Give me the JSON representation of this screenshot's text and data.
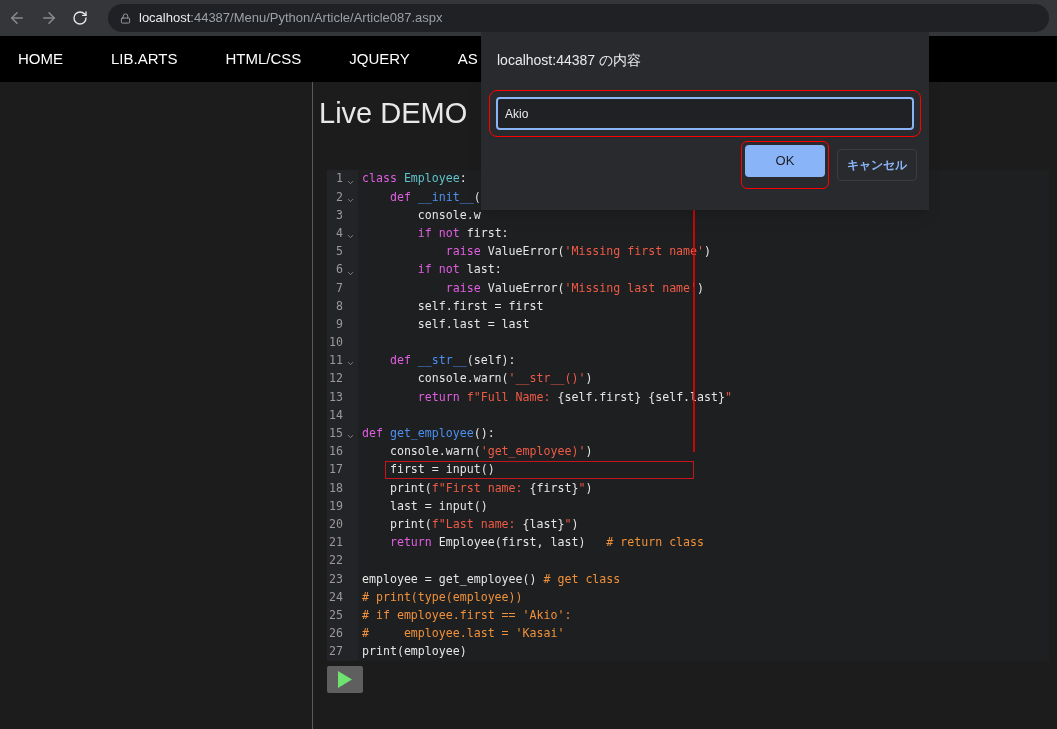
{
  "browser": {
    "url_host": "localhost",
    "url_path": ":44387/Menu/Python/Article/Article087.aspx"
  },
  "nav": [
    "HOME",
    "LIB.ARTS",
    "HTML/CSS",
    "JQUERY",
    "AS"
  ],
  "page_title": "Live DEMO",
  "code_lines": [
    {
      "number": "1",
      "foldable": true,
      "highlighted": false,
      "tokens": [
        {
          "kind": "keyword",
          "text": "class"
        },
        {
          "kind": "class",
          "text": " Employee"
        },
        {
          "kind": "plain",
          "text": ":"
        }
      ]
    },
    {
      "number": "2",
      "foldable": true,
      "highlighted": false,
      "tokens": [
        {
          "kind": "keyword",
          "text": "    def"
        },
        {
          "kind": "function",
          "text": " __init__"
        },
        {
          "kind": "plain",
          "text": "("
        }
      ]
    },
    {
      "number": "3",
      "foldable": false,
      "highlighted": false,
      "tokens": [
        {
          "kind": "plain",
          "text": "        console.w"
        }
      ]
    },
    {
      "number": "4",
      "foldable": true,
      "highlighted": false,
      "tokens": [
        {
          "kind": "keyword",
          "text": "        if not"
        },
        {
          "kind": "plain",
          "text": " first:"
        }
      ]
    },
    {
      "number": "5",
      "foldable": false,
      "highlighted": false,
      "tokens": [
        {
          "kind": "keyword",
          "text": "            raise"
        },
        {
          "kind": "plain",
          "text": " ValueError("
        },
        {
          "kind": "string",
          "text": "'Missing first name'"
        },
        {
          "kind": "plain",
          "text": ")"
        }
      ]
    },
    {
      "number": "6",
      "foldable": true,
      "highlighted": false,
      "tokens": [
        {
          "kind": "keyword",
          "text": "        if not"
        },
        {
          "kind": "plain",
          "text": " last:"
        }
      ]
    },
    {
      "number": "7",
      "foldable": false,
      "highlighted": false,
      "tokens": [
        {
          "kind": "keyword",
          "text": "            raise"
        },
        {
          "kind": "plain",
          "text": " ValueError("
        },
        {
          "kind": "string",
          "text": "'Missing last name'"
        },
        {
          "kind": "plain",
          "text": ")"
        }
      ]
    },
    {
      "number": "8",
      "foldable": false,
      "highlighted": false,
      "tokens": [
        {
          "kind": "plain",
          "text": "        self.first = first"
        }
      ]
    },
    {
      "number": "9",
      "foldable": false,
      "highlighted": false,
      "tokens": [
        {
          "kind": "plain",
          "text": "        self.last = last"
        }
      ]
    },
    {
      "number": "10",
      "foldable": false,
      "highlighted": false
    },
    {
      "number": "11",
      "foldable": true,
      "highlighted": false,
      "tokens": [
        {
          "kind": "keyword",
          "text": "    def"
        },
        {
          "kind": "function",
          "text": " __str__"
        },
        {
          "kind": "plain",
          "text": "(self):"
        }
      ]
    },
    {
      "number": "12",
      "foldable": false,
      "highlighted": false,
      "tokens": [
        {
          "kind": "plain",
          "text": "        console.warn("
        },
        {
          "kind": "string",
          "text": "'__str__()'"
        },
        {
          "kind": "plain",
          "text": ")"
        }
      ]
    },
    {
      "number": "13",
      "foldable": false,
      "highlighted": false,
      "tokens": [
        {
          "kind": "keyword",
          "text": "        return"
        },
        {
          "kind": "string",
          "text": " f\"Full Name: "
        },
        {
          "kind": "plain",
          "text": "{self.first} {self.last}"
        },
        {
          "kind": "string",
          "text": "\""
        }
      ]
    },
    {
      "number": "14",
      "foldable": false,
      "highlighted": false
    },
    {
      "number": "15",
      "foldable": true,
      "highlighted": false,
      "tokens": [
        {
          "kind": "keyword",
          "text": "def"
        },
        {
          "kind": "function",
          "text": " get_employee"
        },
        {
          "kind": "plain",
          "text": "():"
        }
      ]
    },
    {
      "number": "16",
      "foldable": false,
      "highlighted": false,
      "tokens": [
        {
          "kind": "plain",
          "text": "    console.warn("
        },
        {
          "kind": "string",
          "text": "'get_employee)'"
        },
        {
          "kind": "plain",
          "text": ")"
        }
      ]
    },
    {
      "number": "17",
      "foldable": false,
      "highlighted": true,
      "tokens": [
        {
          "kind": "plain",
          "text": "    first = input()"
        }
      ]
    },
    {
      "number": "18",
      "foldable": false,
      "highlighted": false,
      "tokens": [
        {
          "kind": "plain",
          "text": "    print("
        },
        {
          "kind": "string",
          "text": "f\"First name: "
        },
        {
          "kind": "plain",
          "text": "{first}"
        },
        {
          "kind": "string",
          "text": "\""
        },
        {
          "kind": "plain",
          "text": ")"
        }
      ]
    },
    {
      "number": "19",
      "foldable": false,
      "highlighted": false,
      "tokens": [
        {
          "kind": "plain",
          "text": "    last = input()"
        }
      ]
    },
    {
      "number": "20",
      "foldable": false,
      "highlighted": false,
      "tokens": [
        {
          "kind": "plain",
          "text": "    print("
        },
        {
          "kind": "string",
          "text": "f\"Last name: "
        },
        {
          "kind": "plain",
          "text": "{last}"
        },
        {
          "kind": "string",
          "text": "\""
        },
        {
          "kind": "plain",
          "text": ")"
        }
      ]
    },
    {
      "number": "21",
      "foldable": false,
      "highlighted": false,
      "tokens": [
        {
          "kind": "keyword",
          "text": "    return"
        },
        {
          "kind": "plain",
          "text": " Employee(first, last)"
        },
        {
          "kind": "comment",
          "text": "   # return class"
        }
      ]
    },
    {
      "number": "22",
      "foldable": false,
      "highlighted": false
    },
    {
      "number": "23",
      "foldable": false,
      "highlighted": false,
      "tokens": [
        {
          "kind": "plain",
          "text": "employee = get_employee()"
        },
        {
          "kind": "comment",
          "text": " # get class"
        }
      ]
    },
    {
      "number": "24",
      "foldable": false,
      "highlighted": false,
      "tokens": [
        {
          "kind": "comment",
          "text": "# print(type(employee))"
        }
      ]
    },
    {
      "number": "25",
      "foldable": false,
      "highlighted": false,
      "tokens": [
        {
          "kind": "comment",
          "text": "# if employee.first == 'Akio':"
        }
      ]
    },
    {
      "number": "26",
      "foldable": false,
      "highlighted": false,
      "tokens": [
        {
          "kind": "comment",
          "text": "#     employee.last = 'Kasai'"
        }
      ]
    },
    {
      "number": "27",
      "foldable": false,
      "highlighted": false,
      "tokens": [
        {
          "kind": "plain",
          "text": "print(employee)"
        }
      ]
    }
  ],
  "dialog": {
    "title": "localhost:44387 の内容",
    "input": {
      "value": "Akio",
      "callout": true
    },
    "buttons": [
      {
        "label": "OK",
        "kind": "primary",
        "callout": true
      },
      {
        "label": "キャンセル",
        "kind": "secondary",
        "callout": false
      }
    ]
  }
}
